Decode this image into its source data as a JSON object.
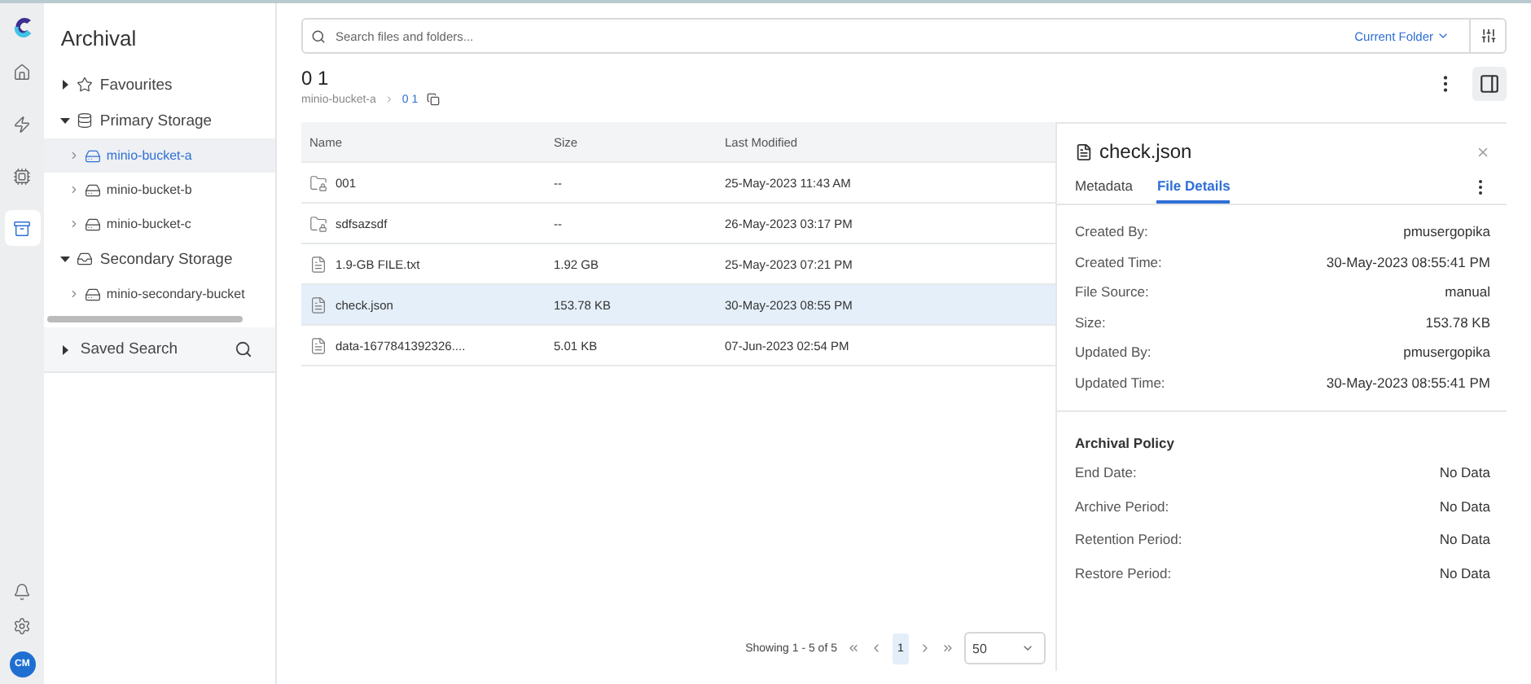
{
  "rail": {
    "items": [
      {
        "kind": "home",
        "selected": false
      },
      {
        "kind": "bolt",
        "selected": false
      },
      {
        "kind": "chip",
        "selected": false
      },
      {
        "kind": "archive",
        "selected": true
      }
    ],
    "bottom": [
      {
        "kind": "bell"
      },
      {
        "kind": "settings"
      }
    ],
    "avatar": "CM"
  },
  "sidebar": {
    "title": "Archival",
    "tree": [
      {
        "label": "Favourites",
        "kind": "star",
        "expanded": false
      },
      {
        "label": "Primary Storage",
        "kind": "database",
        "expanded": true,
        "children": [
          {
            "label": "minio-bucket-a",
            "selected": true
          },
          {
            "label": "minio-bucket-b",
            "selected": false
          },
          {
            "label": "minio-bucket-c",
            "selected": false
          }
        ]
      },
      {
        "label": "Secondary Storage",
        "kind": "inbox",
        "expanded": true,
        "children": [
          {
            "label": "minio-secondary-bucket",
            "selected": false
          }
        ]
      }
    ],
    "saved_search": {
      "label": "Saved Search",
      "expanded": false
    }
  },
  "search": {
    "placeholder": "Search files and folders...",
    "scope": "Current Folder"
  },
  "folder": {
    "title": "0 1",
    "breadcrumb": [
      "minio-bucket-a",
      "0 1"
    ]
  },
  "table": {
    "columns": [
      "Name",
      "Size",
      "Last Modified"
    ],
    "rows": [
      {
        "kind": "folder",
        "name": "001",
        "size": "--",
        "modified": "25-May-2023 11:43 AM",
        "selected": false
      },
      {
        "kind": "folder",
        "name": "sdfsazsdf",
        "size": "--",
        "modified": "26-May-2023 03:17 PM",
        "selected": false
      },
      {
        "kind": "file",
        "name": "1.9-GB FILE.txt",
        "size": "1.92 GB",
        "modified": "25-May-2023 07:21 PM",
        "selected": false
      },
      {
        "kind": "file",
        "name": "check.json",
        "size": "153.78 KB",
        "modified": "30-May-2023 08:55 PM",
        "selected": true
      },
      {
        "kind": "file",
        "name": "data-1677841392326....",
        "size": "5.01 KB",
        "modified": "07-Jun-2023 02:54 PM",
        "selected": false
      }
    ]
  },
  "pagination": {
    "summary": "Showing 1 - 5 of 5",
    "pages": [
      {
        "label": "1",
        "selected": true
      }
    ],
    "page_size": "50"
  },
  "details": {
    "title": "check.json",
    "tabs": [
      {
        "label": "Metadata",
        "selected": false
      },
      {
        "label": "File Details",
        "selected": true
      }
    ],
    "fields": [
      {
        "label": "Created By:",
        "value": "pmusergopika"
      },
      {
        "label": "Created Time:",
        "value": "30-May-2023 08:55:41 PM"
      },
      {
        "label": "File Source:",
        "value": "manual"
      },
      {
        "label": "Size:",
        "value": "153.78 KB"
      },
      {
        "label": "Updated By:",
        "value": "pmusergopika"
      },
      {
        "label": "Updated Time:",
        "value": "30-May-2023 08:55:41 PM"
      }
    ],
    "policy_title": "Archival Policy",
    "policy": [
      {
        "label": "End Date:",
        "value": "No Data"
      },
      {
        "label": "Archive Period:",
        "value": "No Data"
      },
      {
        "label": "Retention Period:",
        "value": "No Data"
      },
      {
        "label": "Restore Period:",
        "value": "No Data"
      }
    ]
  }
}
